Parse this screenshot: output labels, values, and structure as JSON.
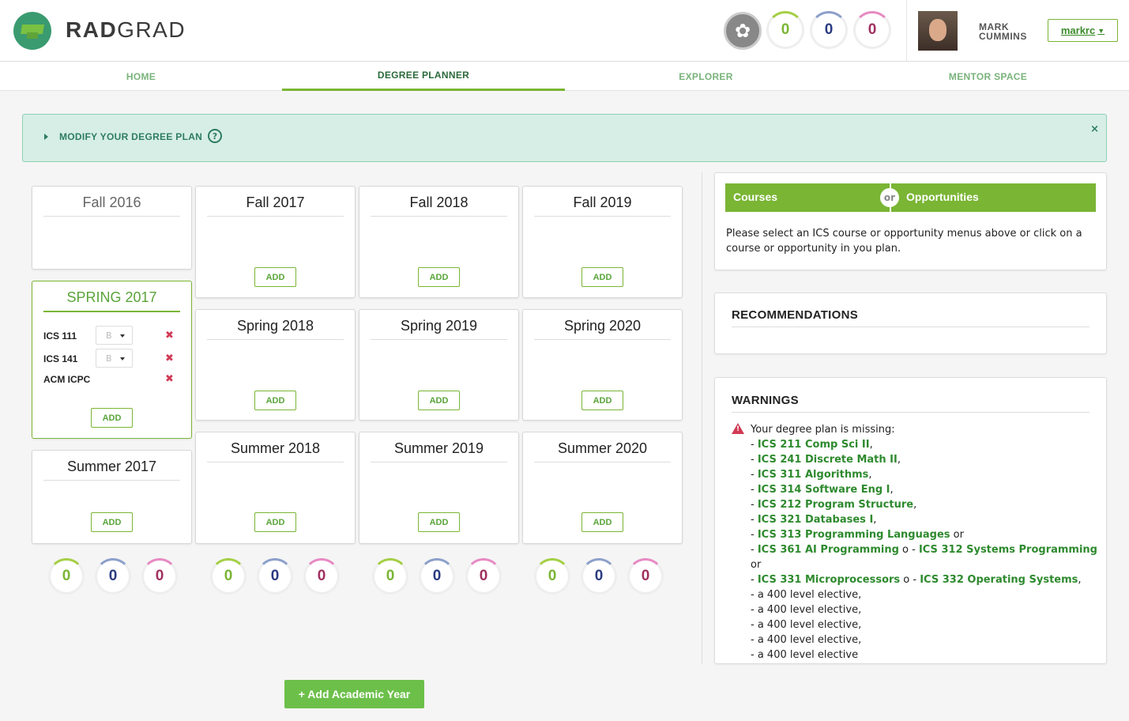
{
  "header": {
    "brand_rad": "RAD",
    "brand_grad": "GRAD",
    "score_ice": {
      "innovation": "0",
      "competency": "0",
      "experience": "0"
    },
    "user_first": "MARK",
    "user_last": "CUMMINS",
    "user_button": "markrc",
    "icons": [
      "graduation-cap-logo",
      "flower-badge-icon",
      "avatar-photo",
      "caret-down-icon"
    ]
  },
  "nav": {
    "tabs": [
      "HOME",
      "DEGREE PLANNER",
      "EXPLORER",
      "MENTOR SPACE"
    ],
    "active": "DEGREE PLANNER"
  },
  "modify": {
    "label": "MODIFY YOUR DEGREE PLAN",
    "help": "?",
    "close": "×"
  },
  "semesters": {
    "fall2016": "Fall 2016",
    "fall2017": "Fall 2017",
    "fall2018": "Fall 2018",
    "fall2019": "Fall 2019",
    "spring2017": "SPRING 2017",
    "spring2018": "Spring 2018",
    "spring2019": "Spring 2019",
    "spring2020": "Spring 2020",
    "summer2017": "Summer 2017",
    "summer2018": "Summer 2018",
    "summer2019": "Summer 2019",
    "summer2020": "Summer 2020",
    "add_label": "ADD",
    "spring2017_items": [
      {
        "name": "ICS 111",
        "grade": "B"
      },
      {
        "name": "ICS 141",
        "grade": "B"
      },
      {
        "name": "ACM ICPC",
        "grade": ""
      }
    ],
    "delete_glyph": "✖"
  },
  "year_scores": [
    {
      "i": "0",
      "c": "0",
      "e": "0"
    },
    {
      "i": "0",
      "c": "0",
      "e": "0"
    },
    {
      "i": "0",
      "c": "0",
      "e": "0"
    },
    {
      "i": "0",
      "c": "0",
      "e": "0"
    }
  ],
  "add_year": "+ Add Academic Year",
  "right": {
    "chooser_left": "Courses",
    "chooser_or": "or",
    "chooser_right": "Opportunities",
    "select_info": "Please select an ICS course or opportunity menus above or click on a course or opportunity in you plan.",
    "recommendations_title": "RECOMMENDATIONS",
    "warnings_title": "WARNINGS",
    "warning_intro": "Your degree plan is missing:",
    "warn_lines": [
      [
        "- ",
        "ICS 211 Comp Sci II",
        ","
      ],
      [
        "- ",
        "ICS 241 Discrete Math II",
        ","
      ],
      [
        "- ",
        "ICS 311 Algorithms",
        ","
      ],
      [
        "- ",
        "ICS 314 Software Eng I",
        ","
      ],
      [
        "- ",
        "ICS 212 Program Structure",
        ","
      ],
      [
        "- ",
        "ICS 321 Databases I",
        ","
      ],
      [
        "- ",
        "ICS 313 Programming Languages",
        " or"
      ],
      [
        "- ",
        "ICS 361 AI Programming",
        " o - ",
        "ICS 312 Systems Programming",
        " or"
      ],
      [
        "- ",
        "ICS 331 Microprocessors",
        " o - ",
        "ICS 332 Operating Systems",
        ","
      ],
      [
        "- a 400 level elective,"
      ],
      [
        "- a 400 level elective,"
      ],
      [
        "- a 400 level elective,"
      ],
      [
        "- a 400 level elective,"
      ],
      [
        "- a 400 level elective"
      ]
    ]
  },
  "colors": {
    "accent_green": "#7ab534",
    "teal_logo": "#3a9b70",
    "innovation": "#7ab534",
    "competency": "#2a3b80",
    "experience": "#a0305f",
    "delete_red": "#d23a55"
  }
}
